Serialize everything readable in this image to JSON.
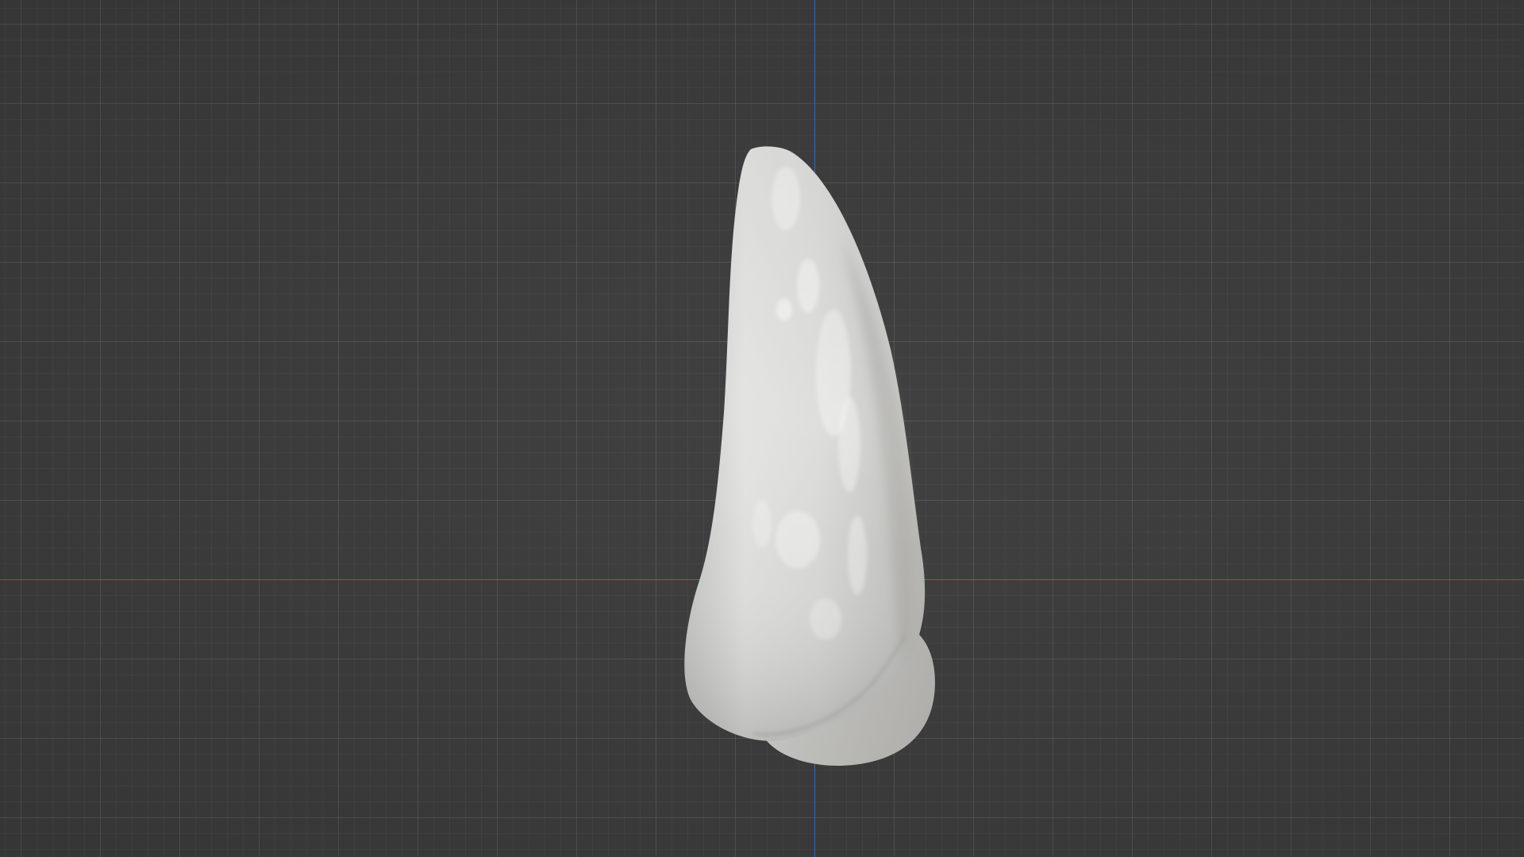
{
  "viewport": {
    "background_color": "#3d3d3d",
    "grid_color": "#4a4a4a"
  },
  "axes": {
    "x_axis_color": "#b0484f",
    "y_axis_color": "#3d6fb0"
  },
  "object": {
    "icon": "tooth-mesh",
    "material_color": "#d8d8d6"
  }
}
